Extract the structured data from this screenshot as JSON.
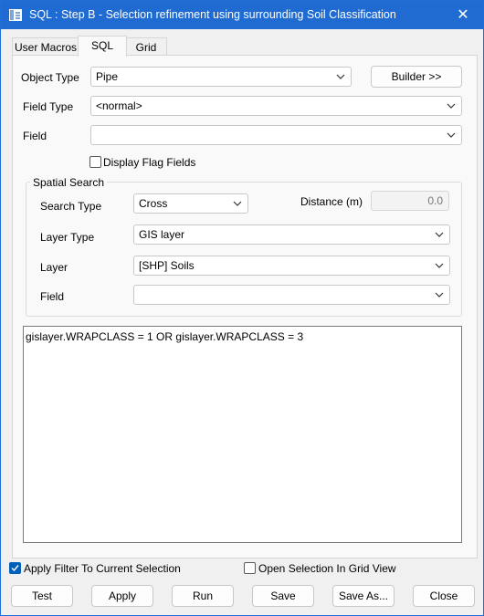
{
  "window": {
    "title": "SQL : Step B - Selection refinement using surrounding Soil Classification",
    "close_glyph": "✕",
    "icon": "app-window-icon"
  },
  "tabs": [
    {
      "label": "User Macros",
      "active": false
    },
    {
      "label": "SQL",
      "active": true
    },
    {
      "label": "Grid",
      "active": false
    }
  ],
  "form": {
    "object_type_label": "Object Type",
    "object_type_value": "Pipe",
    "builder_label": "Builder >>",
    "field_type_label": "Field Type",
    "field_type_value": "<normal>",
    "field_label": "Field",
    "field_value": "",
    "display_flag_fields_label": "Display Flag Fields",
    "display_flag_fields_checked": false
  },
  "spatial_search": {
    "title": "Spatial Search",
    "search_type_label": "Search Type",
    "search_type_value": "Cross",
    "distance_label": "Distance (m)",
    "distance_value": "0.0",
    "layer_type_label": "Layer Type",
    "layer_type_value": "GIS layer",
    "layer_label": "Layer",
    "layer_value": "[SHP] Soils",
    "field_label": "Field",
    "field_value": ""
  },
  "sql_text": "gislayer.WRAPCLASS = 1 OR gislayer.WRAPCLASS = 3",
  "options": {
    "apply_filter_label": "Apply Filter To Current Selection",
    "apply_filter_checked": true,
    "open_in_grid_label": "Open Selection In Grid View",
    "open_in_grid_checked": false
  },
  "buttons": {
    "test": "Test",
    "apply": "Apply",
    "run": "Run",
    "save": "Save",
    "save_as": "Save As...",
    "close": "Close"
  },
  "colors": {
    "titlebar": "#1f6bd1",
    "checkbox_checked": "#005fb8"
  }
}
